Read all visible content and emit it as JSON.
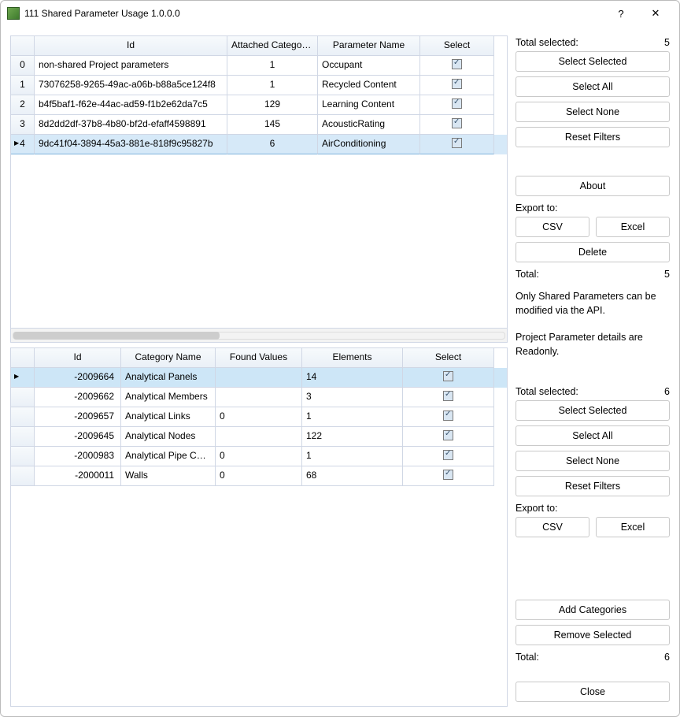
{
  "window": {
    "title": "111 Shared Parameter Usage 1.0.0.0",
    "help": "?",
    "close": "✕"
  },
  "top_grid": {
    "headers": [
      "Id",
      "Attached Categories",
      "Parameter Name",
      "Select"
    ],
    "rows": [
      {
        "n": "0",
        "id": "non-shared Project parameters",
        "cats": "1",
        "pname": "Occupant",
        "sel": true
      },
      {
        "n": "1",
        "id": "73076258-9265-49ac-a06b-b88a5ce124f8",
        "cats": "1",
        "pname": "Recycled Content",
        "sel": true
      },
      {
        "n": "2",
        "id": "b4f5baf1-f62e-44ac-ad59-f1b2e62da7c5",
        "cats": "129",
        "pname": "Learning Content",
        "sel": true
      },
      {
        "n": "3",
        "id": "8d2dd2df-37b8-4b80-bf2d-efaff4598891",
        "cats": "145",
        "pname": "AcousticRating",
        "sel": true
      },
      {
        "n": "4",
        "id": "9dc41f04-3894-45a3-881e-818f9c95827b",
        "cats": "6",
        "pname": "AirConditioning",
        "sel": true
      }
    ]
  },
  "bot_grid": {
    "headers": [
      "Id",
      "Category Name",
      "Found Values",
      "Elements",
      "Select"
    ],
    "rows": [
      {
        "id": "-2009664",
        "cat": "Analytical Panels",
        "fv": "",
        "el": "14",
        "sel": true
      },
      {
        "id": "-2009662",
        "cat": "Analytical Members",
        "fv": "",
        "el": "3",
        "sel": true
      },
      {
        "id": "-2009657",
        "cat": "Analytical Links",
        "fv": "0",
        "el": "1",
        "sel": true
      },
      {
        "id": "-2009645",
        "cat": "Analytical Nodes",
        "fv": "",
        "el": "122",
        "sel": true
      },
      {
        "id": "-2000983",
        "cat": "Analytical Pipe Conne...",
        "fv": "0",
        "el": "1",
        "sel": true
      },
      {
        "id": "-2000011",
        "cat": "Walls",
        "fv": "0",
        "el": "68",
        "sel": true
      }
    ]
  },
  "side_top": {
    "total_sel_label": "Total selected:",
    "total_sel_val": "5",
    "select_selected": "Select Selected",
    "select_all": "Select All",
    "select_none": "Select None",
    "reset_filters": "Reset Filters",
    "about": "About",
    "export_label": "Export to:",
    "csv": "CSV",
    "excel": "Excel",
    "delete": "Delete",
    "total_label": "Total:",
    "total_val": "5",
    "note1": "Only Shared Parameters can be modified via the API.",
    "note2": "Project Parameter details are Readonly."
  },
  "side_bot": {
    "total_sel_label": "Total selected:",
    "total_sel_val": "6",
    "select_selected": "Select Selected",
    "select_all": "Select All",
    "select_none": "Select None",
    "reset_filters": "Reset Filters",
    "export_label": "Export to:",
    "csv": "CSV",
    "excel": "Excel",
    "add_cat": "Add Categories",
    "remove_sel": "Remove Selected",
    "total_label": "Total:",
    "total_val": "6"
  },
  "close_btn": "Close"
}
